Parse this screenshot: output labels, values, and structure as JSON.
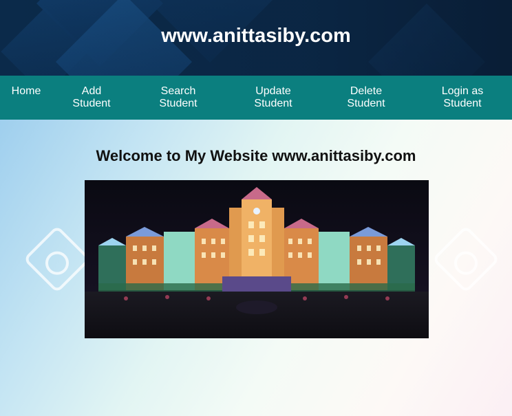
{
  "header": {
    "site_title": "www.anittasiby.com"
  },
  "nav": {
    "items": [
      {
        "label_line1": "Home",
        "label_line2": ""
      },
      {
        "label_line1": "Add",
        "label_line2": "Student"
      },
      {
        "label_line1": "Search",
        "label_line2": "Student"
      },
      {
        "label_line1": "Update",
        "label_line2": "Student"
      },
      {
        "label_line1": "Delete",
        "label_line2": "Student"
      },
      {
        "label_line1": "Login as",
        "label_line2": "Student"
      }
    ]
  },
  "main": {
    "welcome_text": "Welcome to My Website www.anittasiby.com",
    "image": "college-building-night-photo"
  },
  "colors": {
    "header_bg": "#0b2a4a",
    "nav_bg": "#0b7f7f",
    "nav_text": "#ffffff",
    "welcome_text": "#111111"
  }
}
